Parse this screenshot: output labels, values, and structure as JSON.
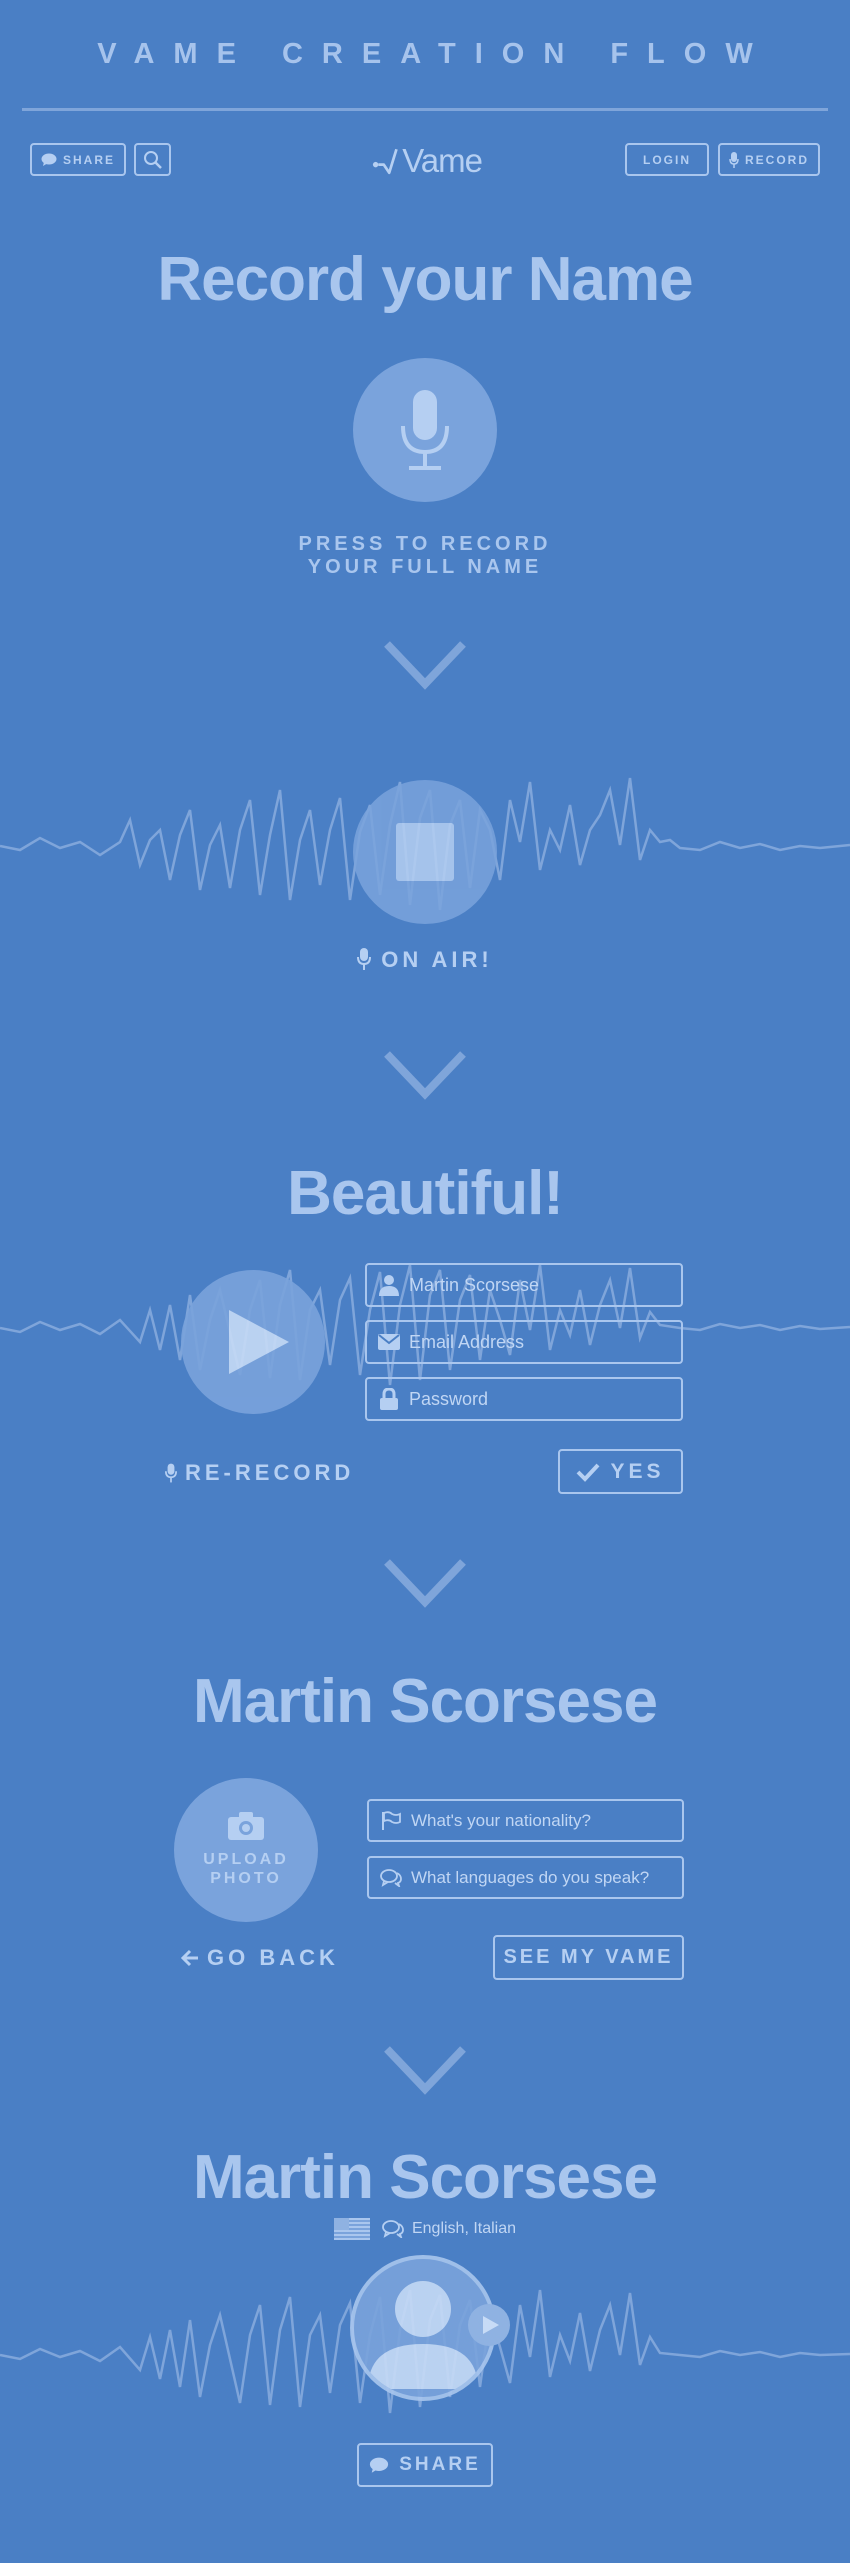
{
  "flow_title": "VAME CREATION FLOW",
  "header": {
    "share_label": "SHARE",
    "logo_text": "Vame",
    "login_label": "LOGIN",
    "record_label": "RECORD"
  },
  "step1": {
    "title": "Record your Name",
    "press_line1": "PRESS TO RECORD",
    "press_line2": "YOUR FULL NAME"
  },
  "step2": {
    "on_air": "ON AIR!"
  },
  "step3": {
    "title": "Beautiful!",
    "name_value": "Martin Scorsese",
    "email_placeholder": "Email Address",
    "password_placeholder": "Password",
    "rerecord_label": "RE-RECORD",
    "yes_label": "YES"
  },
  "step4": {
    "title": "Martin Scorsese",
    "upload_line1": "UPLOAD",
    "upload_line2": "PHOTO",
    "nationality_placeholder": "What's your nationality?",
    "languages_placeholder": "What languages do you speak?",
    "go_back_label": "GO BACK",
    "see_vame_label": "SEE MY VAME"
  },
  "step5": {
    "title": "Martin Scorsese",
    "languages": "English, Italian",
    "share_label": "SHARE"
  },
  "colors": {
    "background": "#4a7fc5",
    "accent_light": "#a9c6ee",
    "circle_fill": "#7aa3dc"
  }
}
